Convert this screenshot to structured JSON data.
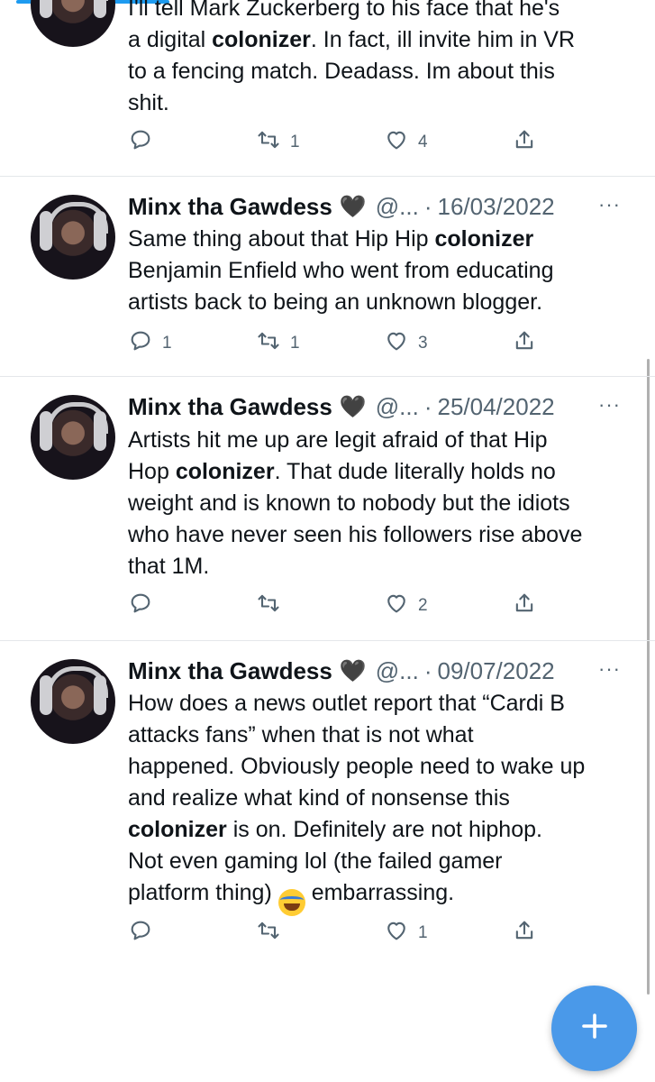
{
  "tweets": [
    {
      "partial": true,
      "body_lines": [
        "I'll tell Mark Zuckerberg to his face that he's",
        "a digital |colonizer|. In fact, ill invite him in VR",
        "to a fencing match. Deadass. Im about this",
        "shit."
      ],
      "stats": {
        "replies": "",
        "retweets": "1",
        "likes": "4"
      }
    },
    {
      "name": "Minx tha Gawdess",
      "heart": "🖤",
      "handle": "@...",
      "sep": "·",
      "date": "16/03/2022",
      "more": "···",
      "body_lines": [
        "Same thing about that Hip Hip |colonizer|",
        "Benjamin Enfield who went from educating",
        "artists back to being an unknown blogger."
      ],
      "stats": {
        "replies": "1",
        "retweets": "1",
        "likes": "3"
      }
    },
    {
      "name": "Minx tha Gawdess",
      "heart": "🖤",
      "handle": "@...",
      "sep": "·",
      "date": "25/04/2022",
      "more": "···",
      "body_lines": [
        "Artists hit me up are legit afraid of that Hip",
        "Hop |colonizer|. That dude literally holds no",
        "weight and is known to nobody but the idiots",
        "who have never seen his followers rise above",
        "that 1M."
      ],
      "stats": {
        "replies": "",
        "retweets": "",
        "likes": "2"
      }
    },
    {
      "name": "Minx tha Gawdess",
      "heart": "🖤",
      "handle": "@...",
      "sep": "·",
      "date": "09/07/2022",
      "more": "···",
      "body_lines": [
        "How does a news outlet report that “Cardi B",
        "attacks fans” when that is not what",
        "happened. Obviously people need to wake up",
        "and realize what kind of nonsense this",
        "|colonizer| is on. Definitely are not hiphop.",
        "Not even gaming lol (the failed gamer",
        "platform thing) [emoji] embarrassing."
      ],
      "emoji": "😂",
      "stats": {
        "replies": "",
        "retweets": "",
        "likes": "1"
      }
    }
  ],
  "fab": {
    "icon": "plus-icon"
  },
  "colors": {
    "accent": "#1d9bf0",
    "fab": "#4a99e9",
    "muted": "#536471",
    "divider": "#e4e7ea"
  }
}
